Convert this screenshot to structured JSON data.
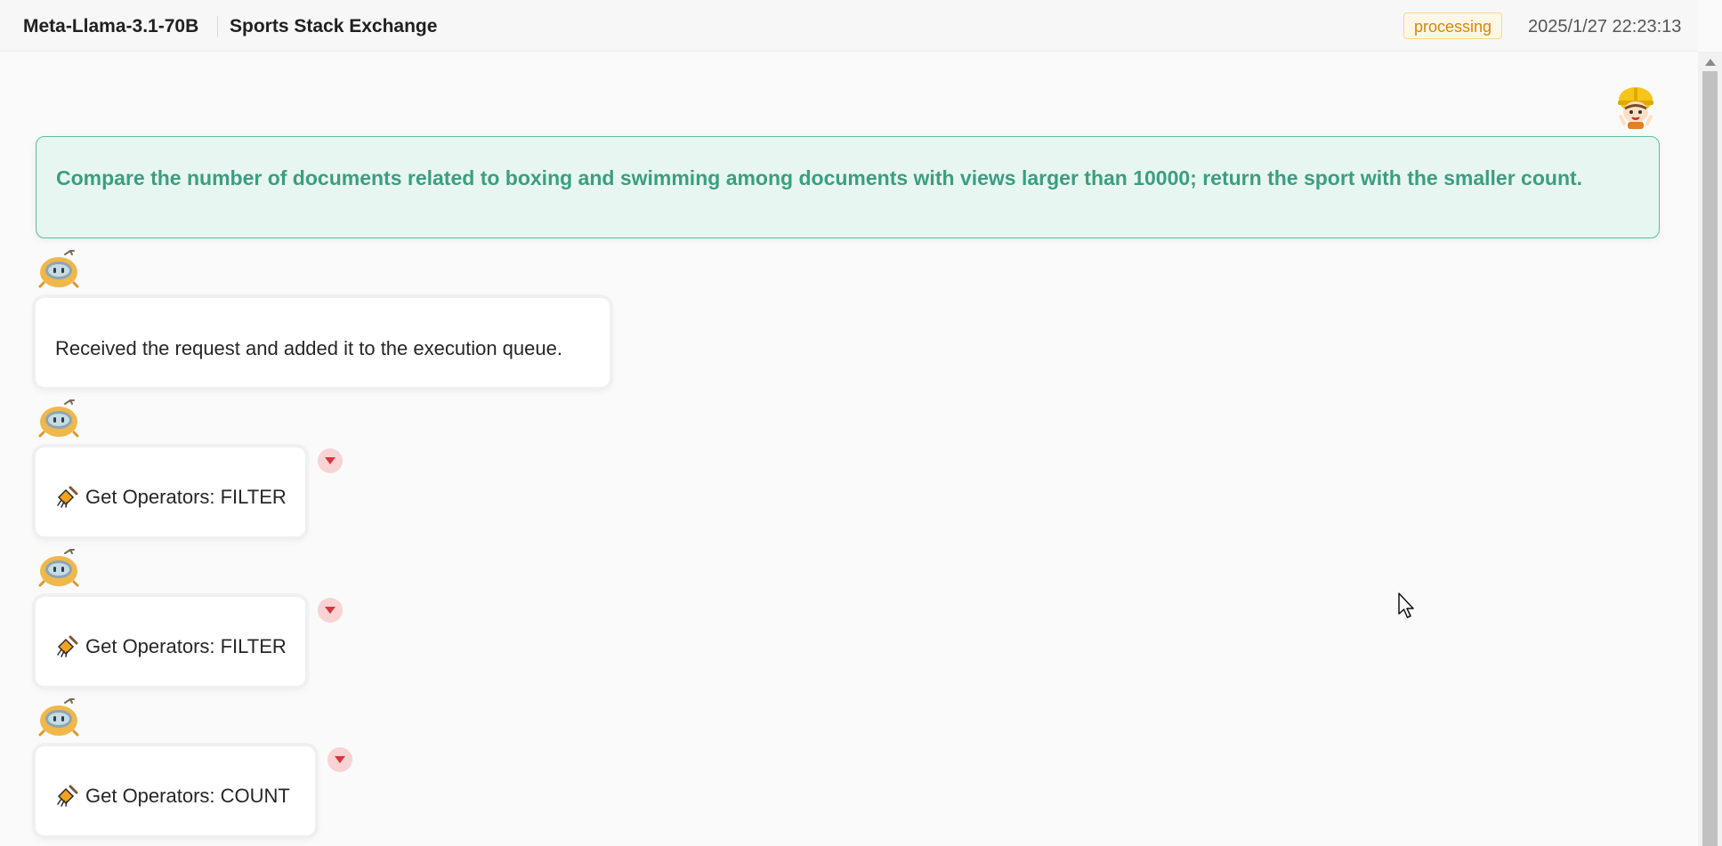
{
  "header": {
    "model": "Meta-Llama-3.1-70B",
    "dataset": "Sports Stack Exchange",
    "status": "processing",
    "timestamp": "2025/1/27 22:23:13"
  },
  "colors": {
    "accent_green": "#3a9f7f",
    "status_orange": "#d48806",
    "toggle_red": "#d9363e"
  },
  "conversation": {
    "user_query": "Compare the number of documents related to boxing and swimming among documents with views larger than 10000; return the sport with the smaller count.",
    "messages": [
      {
        "text": "Received the request and added it to the execution queue.",
        "icon": null,
        "expandable": false
      },
      {
        "text": "Get Operators: FILTER",
        "icon": "broom-icon",
        "expandable": true
      },
      {
        "text": "Get Operators: FILTER",
        "icon": "broom-icon",
        "expandable": true
      },
      {
        "text": "Get Operators: COUNT",
        "icon": "broom-icon",
        "expandable": true
      }
    ]
  }
}
